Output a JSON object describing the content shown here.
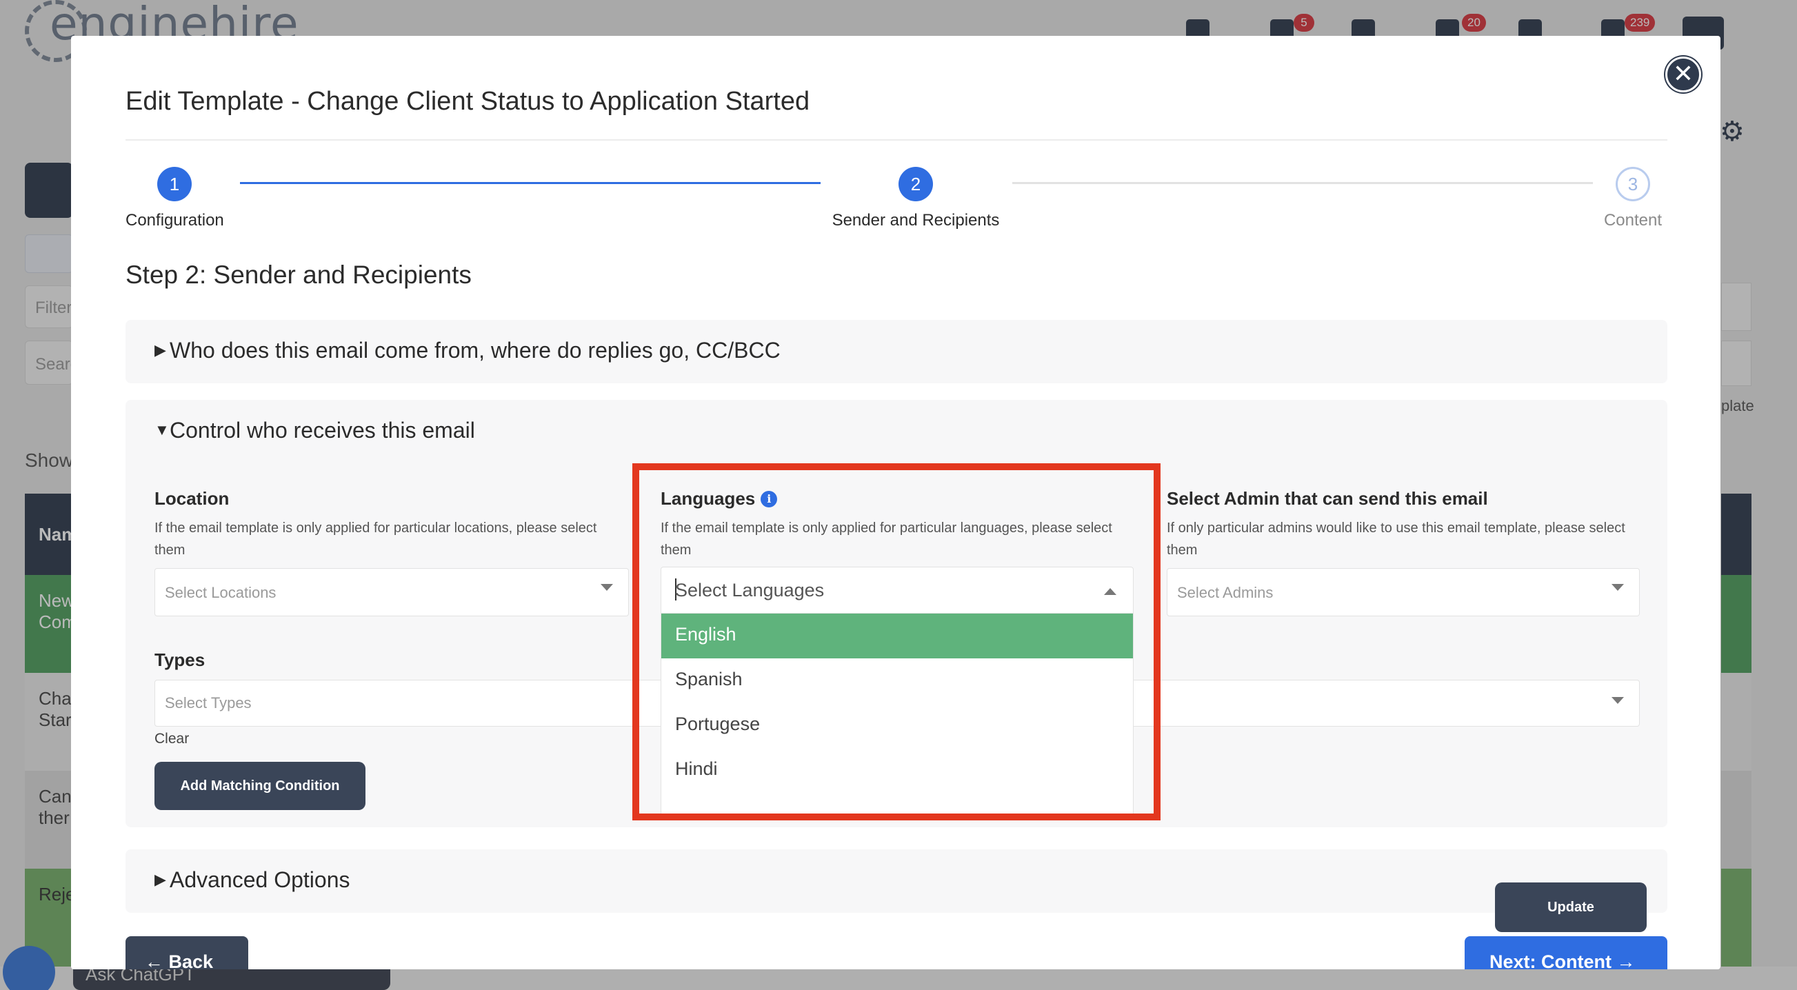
{
  "background": {
    "logo_text": "enginehire",
    "badges": [
      "5",
      "20",
      "239"
    ],
    "filter_placeholder": "Filter",
    "search_placeholder": "Search",
    "show_label": "Show",
    "table_header": "Nam",
    "row_snippets": [
      "New\nCom",
      "Cha\nStar",
      "Can\nther",
      "Reje"
    ],
    "right_snippet": "plate",
    "ask_label": "Ask ChatGPT"
  },
  "modal": {
    "title": "Edit Template - Change Client Status to Application Started",
    "close_label": "✕"
  },
  "stepper": {
    "steps": [
      {
        "number": "1",
        "label": "Configuration",
        "state": "done"
      },
      {
        "number": "2",
        "label": "Sender and Recipients",
        "state": "active"
      },
      {
        "number": "3",
        "label": "Content",
        "state": "pending"
      }
    ]
  },
  "step_heading": "Step 2: Sender and Recipients",
  "sections": {
    "sender": {
      "title": "Who does this email come from, where do replies go, CC/BCC",
      "expanded": false
    },
    "recipients": {
      "title": "Control who receives this email",
      "expanded": true
    },
    "advanced": {
      "title": "Advanced Options",
      "expanded": false
    }
  },
  "fields": {
    "location": {
      "label": "Location",
      "help": "If the email template is only applied for particular locations, please select them",
      "placeholder": "Select Locations"
    },
    "languages": {
      "label": "Languages",
      "help": "If the email template is only applied for particular languages, please select them",
      "placeholder": "Select Languages",
      "options": [
        "English",
        "Spanish",
        "Portugese",
        "Hindi"
      ],
      "highlighted": "English"
    },
    "admin": {
      "label": "Select Admin that can send this email",
      "help": "If only particular admins would like to use this email template, please select them",
      "placeholder": "Select Admins"
    },
    "types": {
      "label": "Types",
      "placeholder": "Select Types",
      "clear_label": "Clear"
    }
  },
  "buttons": {
    "add_condition": "Add Matching Condition",
    "update": "Update",
    "back": "← Back",
    "next": "Next: Content →"
  },
  "colors": {
    "primary": "#2f6de1",
    "dark_button": "#3a4558",
    "selected_option": "#5fb37c",
    "highlight_box": "#e3371e"
  }
}
